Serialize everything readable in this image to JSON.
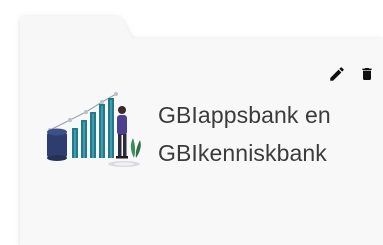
{
  "card": {
    "title_line1": "GBIappsbank en",
    "title_line2": "GBIkenniskbank",
    "actions": {
      "edit_icon": "pencil-icon",
      "delete_icon": "trash-icon"
    },
    "illustration": "analytics-bar-chart-illustration"
  },
  "colors": {
    "folder_fill": "#f7f7f8",
    "folder_shadow": "#e6e6e9",
    "text": "#3b3b3b",
    "icon": "#111111",
    "bar_teal": "#1f7a8c",
    "bar_navy": "#2d3e6e",
    "accent_purple": "#4b3f8f"
  }
}
